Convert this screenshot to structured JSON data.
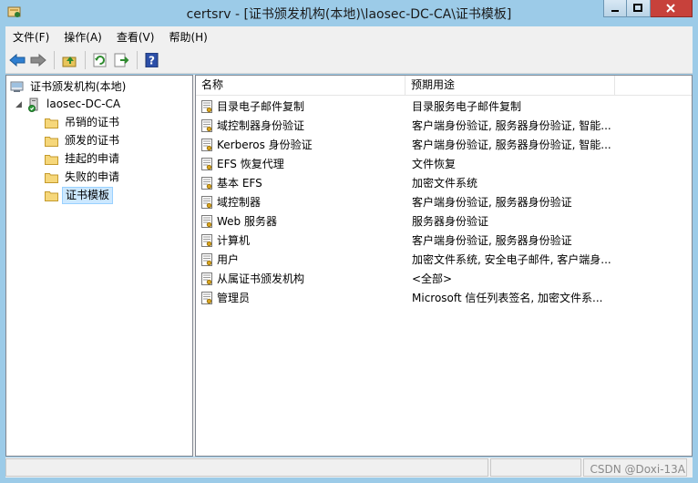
{
  "window": {
    "title": "certsrv - [证书颁发机构(本地)\\laosec-DC-CA\\证书模板]"
  },
  "menu": [
    {
      "label": "文件(F)"
    },
    {
      "label": "操作(A)"
    },
    {
      "label": "查看(V)"
    },
    {
      "label": "帮助(H)"
    }
  ],
  "tree": {
    "root": "证书颁发机构(本地)",
    "ca": "laosec-DC-CA",
    "folders": [
      "吊销的证书",
      "颁发的证书",
      "挂起的申请",
      "失败的申请",
      "证书模板"
    ],
    "selected": "证书模板"
  },
  "list": {
    "columns": [
      "名称",
      "预期用途"
    ],
    "rows": [
      {
        "name": "目录电子邮件复制",
        "purpose": "目录服务电子邮件复制"
      },
      {
        "name": "域控制器身份验证",
        "purpose": "客户端身份验证, 服务器身份验证, 智能..."
      },
      {
        "name": "Kerberos 身份验证",
        "purpose": "客户端身份验证, 服务器身份验证, 智能..."
      },
      {
        "name": "EFS 恢复代理",
        "purpose": "文件恢复"
      },
      {
        "name": "基本 EFS",
        "purpose": "加密文件系统"
      },
      {
        "name": "域控制器",
        "purpose": "客户端身份验证, 服务器身份验证"
      },
      {
        "name": "Web 服务器",
        "purpose": "服务器身份验证"
      },
      {
        "name": "计算机",
        "purpose": "客户端身份验证, 服务器身份验证"
      },
      {
        "name": "用户",
        "purpose": "加密文件系统, 安全电子邮件, 客户端身..."
      },
      {
        "name": "从属证书颁发机构",
        "purpose": "<全部>"
      },
      {
        "name": "管理员",
        "purpose": "Microsoft 信任列表签名, 加密文件系..."
      }
    ]
  },
  "watermark": "CSDN @Doxi-13A",
  "colors": {
    "frame": "#9ccbe8",
    "close_button": "#c7413b",
    "selection": "#cce8ff"
  },
  "icons": {
    "back": "back-arrow-icon",
    "forward": "forward-arrow-icon",
    "up": "up-folder-icon",
    "refresh": "refresh-icon",
    "export": "export-list-icon",
    "help": "help-icon"
  }
}
